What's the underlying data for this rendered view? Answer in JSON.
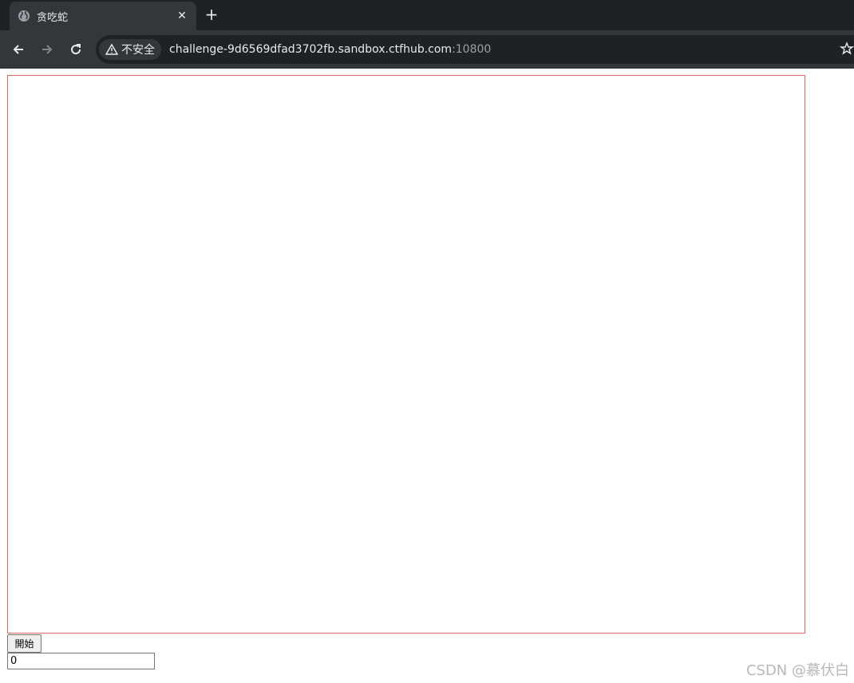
{
  "browser": {
    "tab": {
      "title": "贪吃蛇",
      "close_label": "✕",
      "icon": "globe-icon"
    },
    "new_tab_label": "+",
    "security_chip": "不安全",
    "url_host": "challenge-9d6569dfad3702fb.sandbox.ctfhub.com",
    "url_port": ":10800"
  },
  "page": {
    "canvas_border_color": "#e06666",
    "start_button_label": "開始",
    "score_value": "0"
  },
  "watermark": "CSDN @慕伏白"
}
